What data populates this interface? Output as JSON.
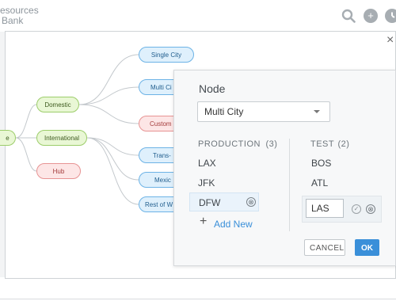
{
  "app": {
    "brand_line1": "esources",
    "brand_line2": "Bank"
  },
  "toolbar": {
    "search_icon": "search-icon",
    "add_icon": "plus-circle-icon",
    "clock_icon": "clock-icon"
  },
  "modal": {
    "close_symbol": "×"
  },
  "tree": {
    "nodes": {
      "root": "e",
      "domestic": "Domestic",
      "international": "International",
      "hub": "Hub",
      "single_city": "Single City",
      "multi_city": "Multi Ci",
      "custom": "Custom",
      "trans": "Trans-",
      "mexico": "Mexic",
      "rest_of_world": "Rest of W"
    }
  },
  "node_editor": {
    "node_label": "Node",
    "selected_node": "Multi City",
    "production": {
      "header": "PRODUCTION",
      "count": "(3)",
      "items": [
        "LAX",
        "JFK",
        "DFW"
      ]
    },
    "test": {
      "header": "TEST",
      "count": "(2)",
      "items": [
        "BOS",
        "ATL"
      ],
      "editing_value": "LAS"
    },
    "add_new_label": "Add New",
    "remove_symbol": "⊗",
    "confirm_symbol": "✓",
    "cancel_label": "CANCEL",
    "ok_label": "OK",
    "colors": {
      "accent": "#3a8fd9",
      "green_node": "#9ccd6a",
      "blue_node": "#6db3e6",
      "red_node": "#e79393"
    }
  }
}
